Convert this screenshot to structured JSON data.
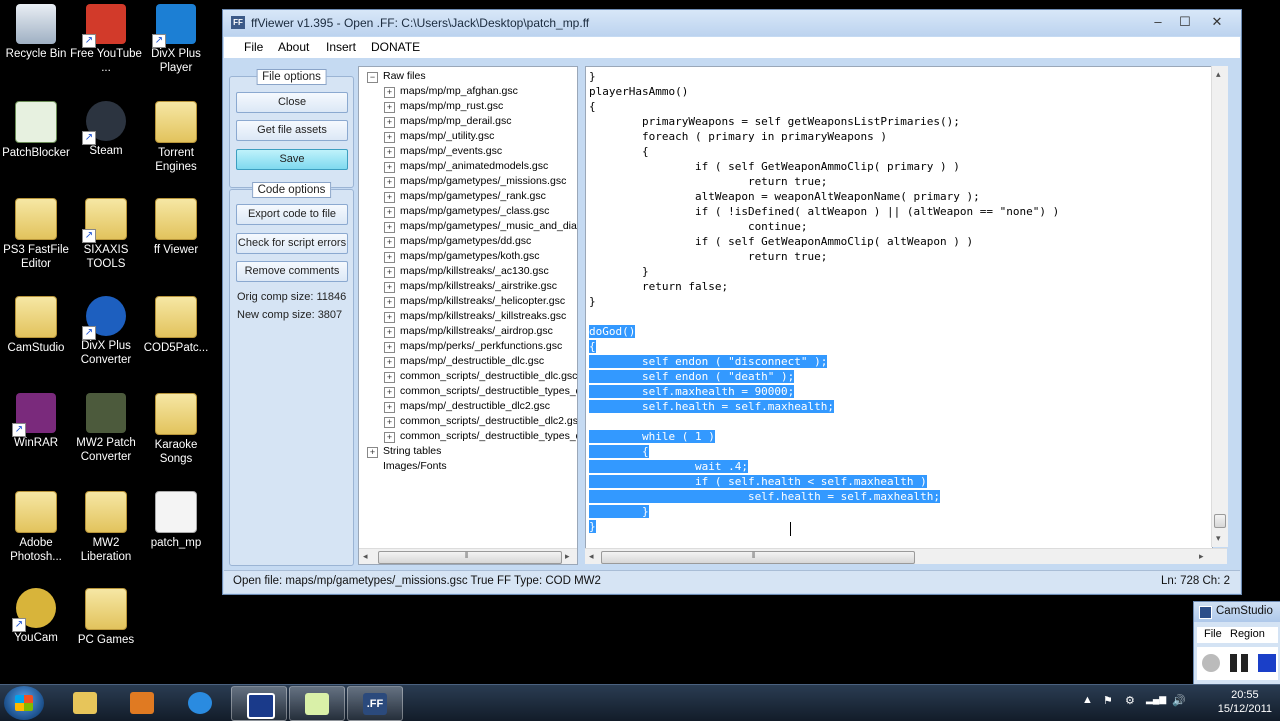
{
  "desktop_icons": [
    {
      "label": "Recycle Bin"
    },
    {
      "label": "Free YouTube ..."
    },
    {
      "label": "DivX Plus Player"
    },
    {
      "label": "PatchBlocker"
    },
    {
      "label": "Steam"
    },
    {
      "label": "Torrent Engines"
    },
    {
      "label": "PS3 FastFile Editor"
    },
    {
      "label": "SIXAXIS TOOLS"
    },
    {
      "label": "ff Viewer"
    },
    {
      "label": "CamStudio"
    },
    {
      "label": "DivX Plus Converter"
    },
    {
      "label": "COD5Patc..."
    },
    {
      "label": "WinRAR"
    },
    {
      "label": "MW2 Patch Converter"
    },
    {
      "label": "Karaoke Songs"
    },
    {
      "label": "Adobe Photosh..."
    },
    {
      "label": "MW2 Liberation"
    },
    {
      "label": "patch_mp"
    },
    {
      "label": "YouCam"
    },
    {
      "label": "PC Games"
    }
  ],
  "window": {
    "title": "ffViewer v1.395 - Open .FF: C:\\Users\\Jack\\Desktop\\patch_mp.ff",
    "icon_text": "FF",
    "minimize": "–",
    "maximize": "☐",
    "close": "✕"
  },
  "menu": [
    "File",
    "About",
    "Insert",
    "DONATE"
  ],
  "file_options": {
    "title": "File options",
    "buttons": [
      "Close",
      "Get file assets",
      "Save"
    ]
  },
  "code_options": {
    "title": "Code options",
    "buttons": [
      "Export code to file",
      "Check for script errors",
      "Remove comments"
    ],
    "orig_comp_size": "Orig comp size: 11846",
    "new_comp_size": "New comp size: 3807"
  },
  "tree": {
    "root": "Raw files",
    "items": [
      "maps/mp/mp_afghan.gsc",
      "maps/mp/mp_rust.gsc",
      "maps/mp/mp_derail.gsc",
      "maps/mp/_utility.gsc",
      "maps/mp/_events.gsc",
      "maps/mp/_animatedmodels.gsc",
      "maps/mp/gametypes/_missions.gsc",
      "maps/mp/gametypes/_rank.gsc",
      "maps/mp/gametypes/_class.gsc",
      "maps/mp/gametypes/_music_and_dialo",
      "maps/mp/gametypes/dd.gsc",
      "maps/mp/gametypes/koth.gsc",
      "maps/mp/killstreaks/_ac130.gsc",
      "maps/mp/killstreaks/_airstrike.gsc",
      "maps/mp/killstreaks/_helicopter.gsc",
      "maps/mp/killstreaks/_killstreaks.gsc",
      "maps/mp/killstreaks/_airdrop.gsc",
      "maps/mp/perks/_perkfunctions.gsc",
      "maps/mp/_destructible_dlc.gsc",
      "common_scripts/_destructible_dlc.gsc",
      "common_scripts/_destructible_types_dlc",
      "maps/mp/_destructible_dlc2.gsc",
      "common_scripts/_destructible_dlc2.gsc",
      "common_scripts/_destructible_types_dlc"
    ],
    "string_tables": "String tables",
    "images_fonts": "Images/Fonts",
    "expand_symbol": "+",
    "collapse_symbol": "−"
  },
  "code_lines": [
    {
      "text": "}",
      "sel": false
    },
    {
      "text": "playerHasAmmo()",
      "sel": false
    },
    {
      "text": "{",
      "sel": false
    },
    {
      "text": "        primaryWeapons = self getWeaponsListPrimaries();",
      "sel": false
    },
    {
      "text": "        foreach ( primary in primaryWeapons )",
      "sel": false
    },
    {
      "text": "        {",
      "sel": false
    },
    {
      "text": "                if ( self GetWeaponAmmoClip( primary ) )",
      "sel": false
    },
    {
      "text": "                        return true;",
      "sel": false
    },
    {
      "text": "                altWeapon = weaponAltWeaponName( primary );",
      "sel": false
    },
    {
      "text": "                if ( !isDefined( altWeapon ) || (altWeapon == \"none\") )",
      "sel": false
    },
    {
      "text": "                        continue;",
      "sel": false
    },
    {
      "text": "                if ( self GetWeaponAmmoClip( altWeapon ) )",
      "sel": false
    },
    {
      "text": "                        return true;",
      "sel": false
    },
    {
      "text": "        }",
      "sel": false
    },
    {
      "text": "        return false;",
      "sel": false
    },
    {
      "text": "}",
      "sel": false
    },
    {
      "text": "",
      "sel": false
    },
    {
      "text": "doGod()",
      "sel": true
    },
    {
      "text": "{",
      "sel": true
    },
    {
      "text": "        self endon ( \"disconnect\" );",
      "sel": true
    },
    {
      "text": "        self endon ( \"death\" );",
      "sel": true
    },
    {
      "text": "        self.maxhealth = 90000;",
      "sel": true
    },
    {
      "text": "        self.health = self.maxhealth;",
      "sel": true
    },
    {
      "text": "",
      "sel": true
    },
    {
      "text": "        while ( 1 )",
      "sel": true
    },
    {
      "text": "        {",
      "sel": true
    },
    {
      "text": "                wait .4;",
      "sel": true
    },
    {
      "text": "                if ( self.health < self.maxhealth )",
      "sel": true
    },
    {
      "text": "                        self.health = self.maxhealth;",
      "sel": true
    },
    {
      "text": "        }",
      "sel": true
    },
    {
      "text": "}",
      "sel": true
    }
  ],
  "status": {
    "left": "Open file: maps/mp/gametypes/_missions.gsc   True   FF Type: COD MW2",
    "right": "Ln: 728 Ch: 2"
  },
  "scroll_arrows": {
    "left": "◂",
    "right": "▸",
    "up": "▴",
    "down": "▾",
    "grip": "⦀"
  },
  "taskbar": {
    "clock_time": "20:55",
    "clock_date": "15/12/2011",
    "tray_symbols": [
      "▲",
      "⚑",
      "⚙",
      "▂▄▆",
      "🔊"
    ],
    "ff_task_label": ".FF"
  },
  "camstudio": {
    "title": "CamStudio",
    "menu": [
      "File",
      "Region"
    ]
  },
  "colors": {
    "selection": "#3399ff",
    "accent_button": "#7fd9ef"
  }
}
